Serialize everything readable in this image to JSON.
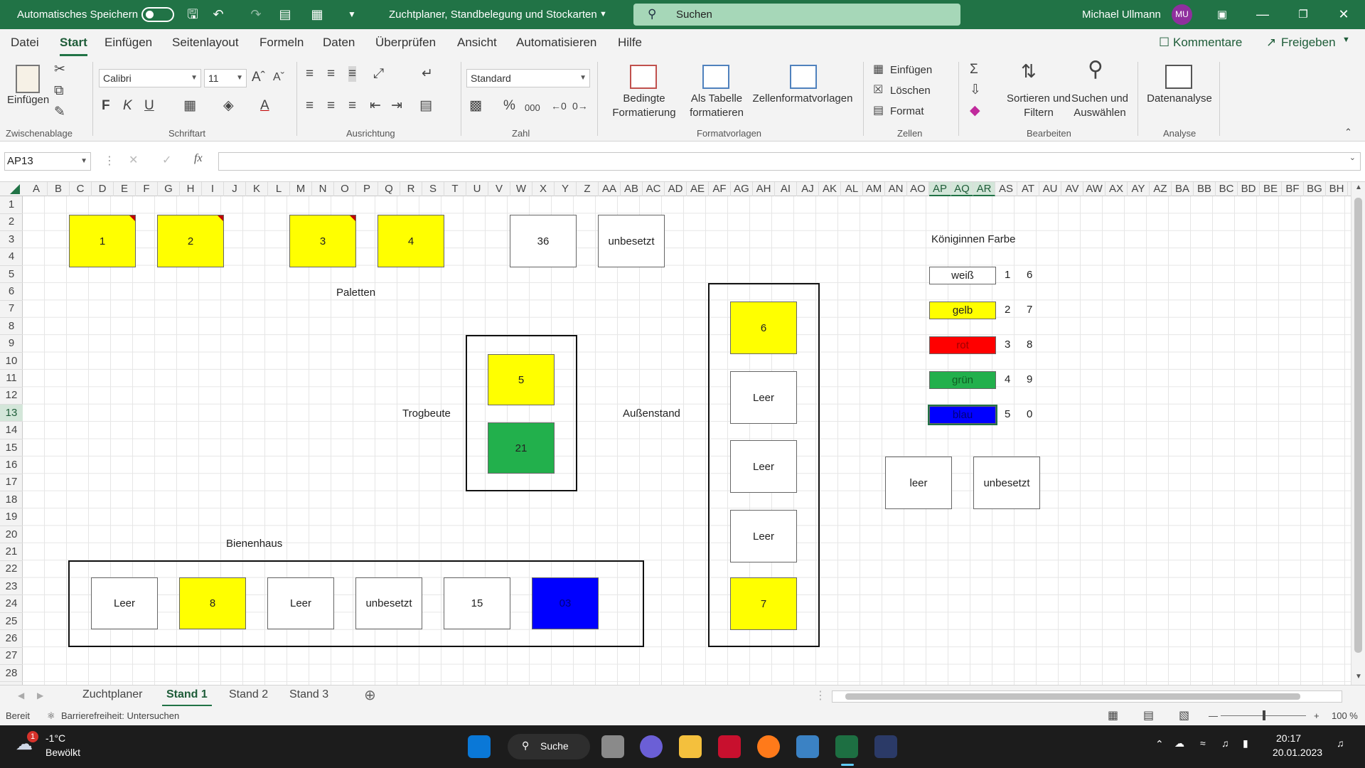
{
  "titlebar": {
    "autosave_label": "Automatisches Speichern",
    "document_title": "Zuchtplaner, Standbelegung und Stockarten",
    "search_placeholder": "Suchen",
    "user_name": "Michael Ullmann",
    "user_initials": "MU",
    "accent_color": "#217346"
  },
  "menu": {
    "tabs": [
      "Datei",
      "Start",
      "Einfügen",
      "Seitenlayout",
      "Formeln",
      "Daten",
      "Überprüfen",
      "Ansicht",
      "Automatisieren",
      "Hilfe"
    ],
    "active": "Start",
    "comments": "Kommentare",
    "share": "Freigeben"
  },
  "ribbon": {
    "paste_label": "Einfügen",
    "font_name": "Calibri",
    "font_size": "11",
    "bold": "F",
    "italic": "K",
    "underline": "U",
    "number_format": "Standard",
    "cond_format_1": "Bedingte",
    "cond_format_2": "Formatierung",
    "as_table_1": "Als Tabelle",
    "as_table_2": "formatieren",
    "cell_styles": "Zellenformatvorlagen",
    "insert": "Einfügen",
    "delete": "Löschen",
    "format": "Format",
    "sort_1": "Sortieren und",
    "sort_2": "Filtern",
    "find_1": "Suchen und",
    "find_2": "Auswählen",
    "analysis": "Datenanalyse",
    "groups": {
      "clipboard": "Zwischenablage",
      "font": "Schriftart",
      "alignment": "Ausrichtung",
      "number": "Zahl",
      "styles": "Formatvorlagen",
      "cells": "Zellen",
      "edit": "Bearbeiten",
      "analysis": "Analyse"
    }
  },
  "formula_bar": {
    "name_box": "AP13",
    "fx": "fx",
    "value": ""
  },
  "grid": {
    "columns": [
      "A",
      "B",
      "C",
      "D",
      "E",
      "F",
      "G",
      "H",
      "I",
      "J",
      "K",
      "L",
      "M",
      "N",
      "O",
      "P",
      "Q",
      "R",
      "S",
      "T",
      "U",
      "V",
      "W",
      "X",
      "Y",
      "Z",
      "AA",
      "AB",
      "AC",
      "AD",
      "AE",
      "AF",
      "AG",
      "AH",
      "AI",
      "AJ",
      "AK",
      "AL",
      "AM",
      "AN",
      "AO",
      "AP",
      "AQ",
      "AR",
      "AS",
      "AT",
      "AU",
      "AV",
      "AW",
      "AX",
      "AY",
      "AZ",
      "BA",
      "BB",
      "BC",
      "BD",
      "BE",
      "BF",
      "BG",
      "BH"
    ],
    "selected_columns": [
      "AP",
      "AQ",
      "AR"
    ],
    "rows": [
      "1",
      "2",
      "3",
      "4",
      "5",
      "6",
      "7",
      "8",
      "9",
      "10",
      "11",
      "12",
      "13",
      "14",
      "15",
      "16",
      "17",
      "18",
      "19",
      "20",
      "21",
      "22",
      "23",
      "24",
      "25",
      "26",
      "27",
      "28"
    ],
    "selected_row": "13"
  },
  "sheet": {
    "paletten_boxes": [
      "1",
      "2",
      "3",
      "4"
    ],
    "top_right_boxes": [
      "36",
      "unbesetzt"
    ],
    "labels": {
      "paletten": "Paletten",
      "trogbeute": "Trogbeute",
      "aussenstand": "Außenstand",
      "bienenhaus": "Bienenhaus",
      "koeniginnen_farbe": "Königinnen Farbe"
    },
    "trogbeute_boxes": [
      "5",
      "21"
    ],
    "aussenstand_boxes": [
      "6",
      "Leer",
      "Leer",
      "Leer",
      "7"
    ],
    "bienenhaus_boxes": [
      "Leer",
      "8",
      "Leer",
      "unbesetzt",
      "15",
      "03"
    ],
    "legend": [
      {
        "name": "weiß",
        "a": "1",
        "b": "6",
        "color": "#ffffff"
      },
      {
        "name": "gelb",
        "a": "2",
        "b": "7",
        "color": "#ffff00"
      },
      {
        "name": "rot",
        "a": "3",
        "b": "8",
        "color": "#ff0000"
      },
      {
        "name": "grün",
        "a": "4",
        "b": "9",
        "color": "#22b04c"
      },
      {
        "name": "blau",
        "a": "5",
        "b": "0",
        "color": "#0000ff"
      }
    ],
    "status_boxes": [
      "leer",
      "unbesetzt"
    ]
  },
  "sheet_tabs": [
    "Zuchtplaner",
    "Stand 1",
    "Stand 2",
    "Stand 3"
  ],
  "active_sheet": "Stand 1",
  "status": {
    "ready": "Bereit",
    "accessibility": "Barrierefreiheit: Untersuchen",
    "zoom": "100 %"
  },
  "taskbar": {
    "temp": "-1°C",
    "weather": "Bewölkt",
    "weather_badge": "1",
    "search": "Suche",
    "time": "20:17",
    "date": "20.01.2023"
  }
}
